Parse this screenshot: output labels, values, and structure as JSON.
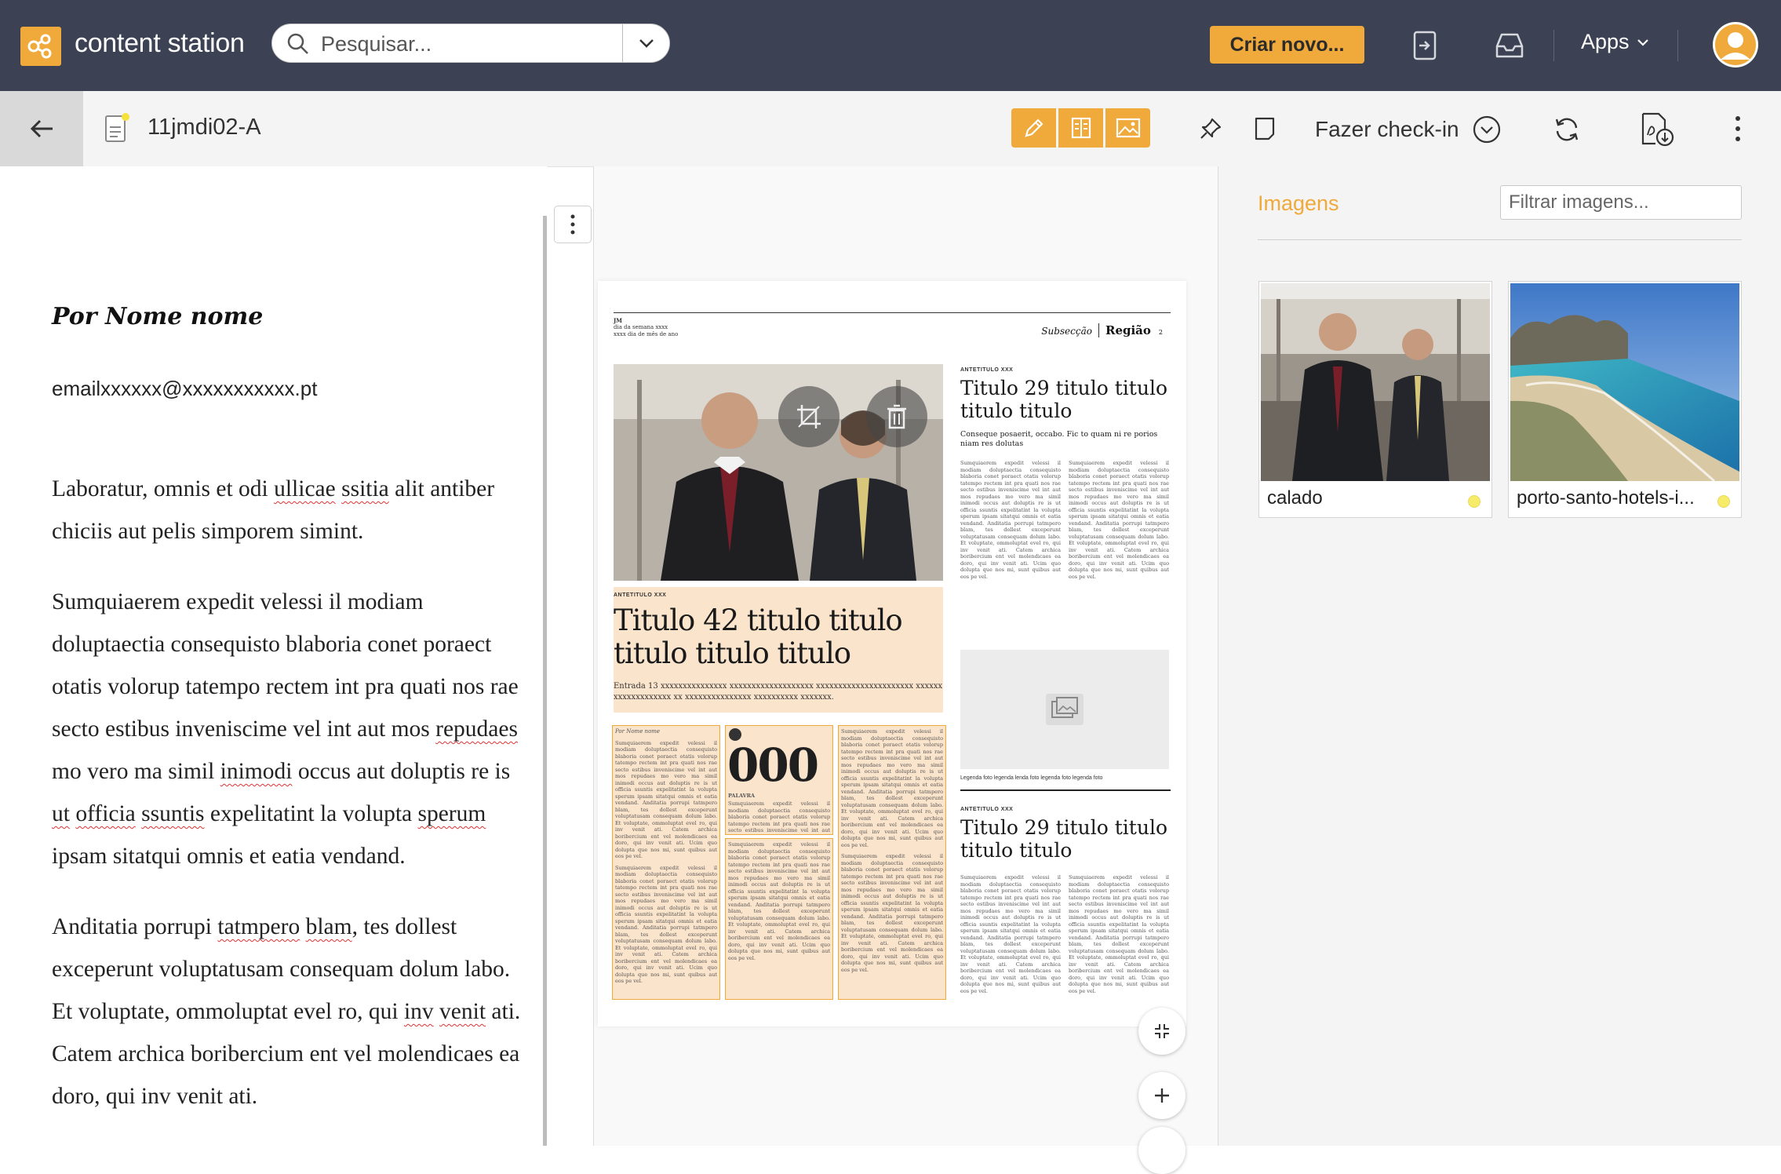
{
  "app": {
    "name": "content station",
    "search_placeholder": "Pesquisar...",
    "create_label": "Criar novo...",
    "apps_label": "Apps",
    "accent_color": "#f0a93b",
    "topbar_color": "#3c4254"
  },
  "document": {
    "name": "11jmdi02-A",
    "checkin_label": "Fazer check-in"
  },
  "editor": {
    "byline": "Por Nome nome",
    "email": "emailxxxxxx@xxxxxxxxxxx.pt",
    "p1_a": "Laboratur, omnis et odi ",
    "p1_s1": "ullicae",
    "p1_b": " ",
    "p1_s2": "ssitia",
    "p1_c": " alit antiber chiciis aut pelis simporem simint.",
    "p2_a": "Sumquiaerem expedit velessi il modiam doluptaectia consequisto blaboria conet poraect otatis volorup tatempo rectem int pra quati nos rae secto estibus inveniscime vel int aut mos ",
    "p2_s1": "repudaes",
    "p2_b": " mo vero ma simil ",
    "p2_s2": "inimodi",
    "p2_c": " occus aut doluptis re is ",
    "p2_s3": "ut",
    "p2_d": " ",
    "p2_s4": "officia",
    "p2_e": " ",
    "p2_s5": "ssuntis",
    "p2_f": " expelitatint la volupta ",
    "p2_s6": "sperum",
    "p2_g": " ipsam sitatqui omnis et eatia vendand.",
    "p3_a": "Anditatia porrupi ",
    "p3_s1": "tatmpero",
    "p3_b": " ",
    "p3_s2": "blam",
    "p3_c": ", tes dollest exceperunt voluptatusam consequam dolum labo. Et voluptate, ommoluptat evel ro, qui ",
    "p3_s3": "inv",
    "p3_d": " ",
    "p3_s4": "venit",
    "p3_e": " ati. Catem archica boribercium ent vel molendicaes ea doro, qui inv venit ati."
  },
  "page_preview": {
    "masthead_1": "JM",
    "masthead_2": "dia da semana xxxx",
    "masthead_3": "xxxx dia de mês de ano",
    "subsection": "Subsecção",
    "region": "Região",
    "page_number": "2",
    "kicker_main": "ANTETITULO XXX",
    "main_title": "Titulo 42 titulo titulo titulo titulo titulo",
    "entrada": "Entrada 13 xxxxxxxxxxxxxxx xxxxxxxxxxxxxxxxxxx xxxxxxxxxxxxxxxxxxxxxx xxxxxxxxxxxxxxxxxxx xx xxxxxxxxxxxxxxx xxxxxxxxxx xxxxxxx.",
    "kicker_r1": "ANTETITULO XXX",
    "title_r1": "Titulo 29 titulo titulo titulo titulo",
    "lead_r1": "Conseque posaerit, occabo. Fic to quam ni re porios niam res dolutas",
    "caption": "Legenda foto legenda lenda foto legenda foto legenda foto",
    "kicker_r2": "ANTETITULO XXX",
    "title_r2": "Titulo 29 titulo titulo titulo titulo",
    "col_byline": "Por Nome nome",
    "big_number": "000",
    "palavra": "PALAVRA",
    "filler": "Sumquiaerem expedit velessi il modiam doluptaectia consequisto blaboria conet poraect otatis volorup tatempo rectem int pra quati nos rae secto estibus inveniscime vel int aut mos repudaes mo vero ma simil inimodi occus aut doluptis re is ut officia ssuntis expelitatint la volupta sperum ipsam sitatqui omnis et eatia vendand. Anditatia porrupi tatmpero blam, tes dollest exceperunt voluptatusam consequam dolum labo. Et voluptate, ommoluptat evel ro, qui inv venit ati. Catem archica boribercium ent vel molendicaes ea doro, qui inv venit ati. Ucim quo dolupta que nos mi, sunt quibus aut eos pe vel."
  },
  "images_panel": {
    "title": "Imagens",
    "filter_placeholder": "Filtrar imagens...",
    "images": [
      {
        "name": "calado"
      },
      {
        "name": "porto-santo-hotels-i..."
      }
    ]
  }
}
